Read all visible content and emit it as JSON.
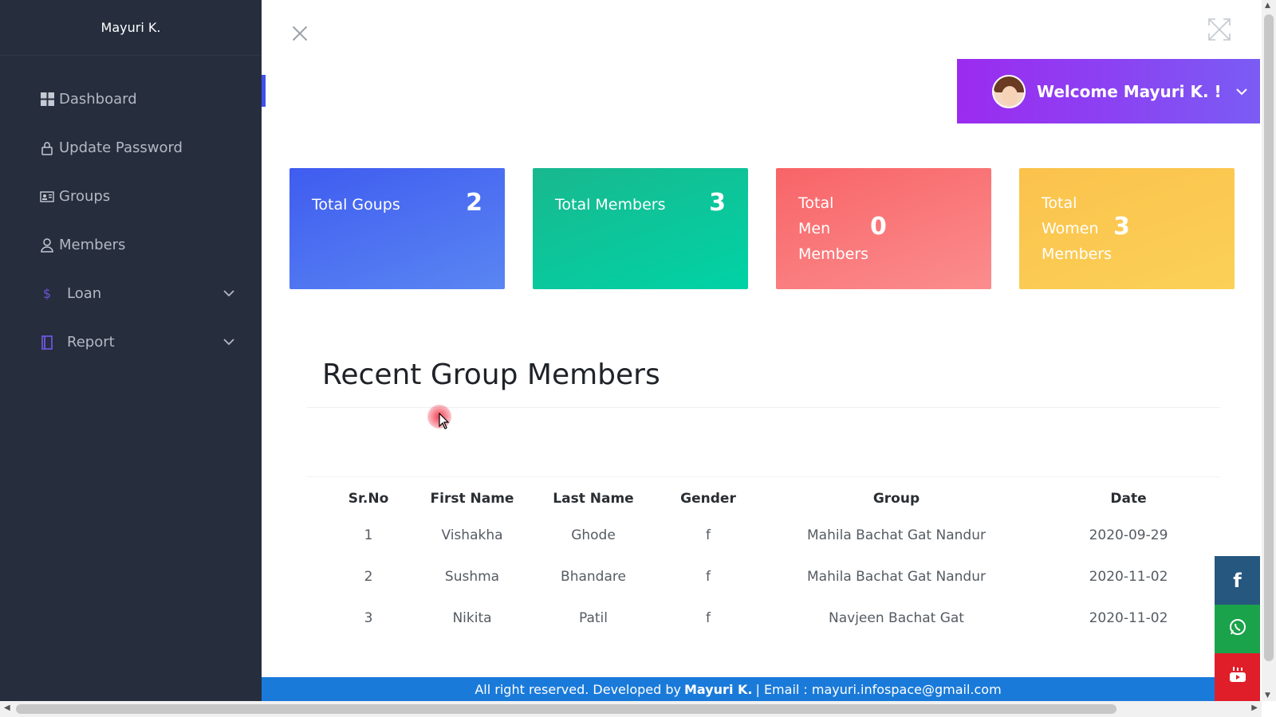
{
  "sidebar": {
    "brand": "Mayuri K.",
    "items": [
      {
        "label": "Dashboard",
        "icon": "grid-icon"
      },
      {
        "label": "Update Password",
        "icon": "lock-icon"
      },
      {
        "label": "Groups",
        "icon": "id-card-icon"
      },
      {
        "label": "Members",
        "icon": "user-icon"
      },
      {
        "label": "Loan",
        "icon": "dollar-icon",
        "has_submenu": true
      },
      {
        "label": "Report",
        "icon": "book-icon",
        "has_submenu": true
      }
    ]
  },
  "header": {
    "welcome": "Welcome Mayuri K. !"
  },
  "stats": [
    {
      "label": "Total Goups",
      "value": "2",
      "color": "#4a6cf1"
    },
    {
      "label": "Total Members",
      "value": "3",
      "color": "#0bc79e"
    },
    {
      "label_lines": [
        "Total",
        "Men",
        "Members"
      ],
      "value": "0",
      "color": "#f9797b"
    },
    {
      "label_lines": [
        "Total",
        "Women",
        "Members"
      ],
      "value": "3",
      "color": "#fbc950"
    }
  ],
  "section": {
    "title": "Recent Group Members"
  },
  "table": {
    "headers": [
      "Sr.No",
      "First Name",
      "Last Name",
      "Gender",
      "Group",
      "Date"
    ],
    "rows": [
      [
        "1",
        "Vishakha",
        "Ghode",
        "f",
        "Mahila Bachat Gat Nandur",
        "2020-09-29"
      ],
      [
        "2",
        "Sushma",
        "Bhandare",
        "f",
        "Mahila Bachat Gat Nandur",
        "2020-11-02"
      ],
      [
        "3",
        "Nikita",
        "Patil",
        "f",
        "Navjeen Bachat Gat",
        "2020-11-02"
      ]
    ]
  },
  "social": {
    "facebook": "f",
    "whatsapp_icon": "whatsapp-icon",
    "youtube_icon": "youtube-icon"
  },
  "footer": {
    "prefix": "All right reserved. Developed by",
    "author": "Mayuri K.",
    "suffix": "| Email : mayuri.infospace@gmail.com"
  },
  "colors": {
    "sidebar_bg": "#262d3d",
    "accent": "#3f51e8",
    "welcome_gradient_start": "#9b2bf0",
    "footer_bg": "#1a7ad9"
  }
}
